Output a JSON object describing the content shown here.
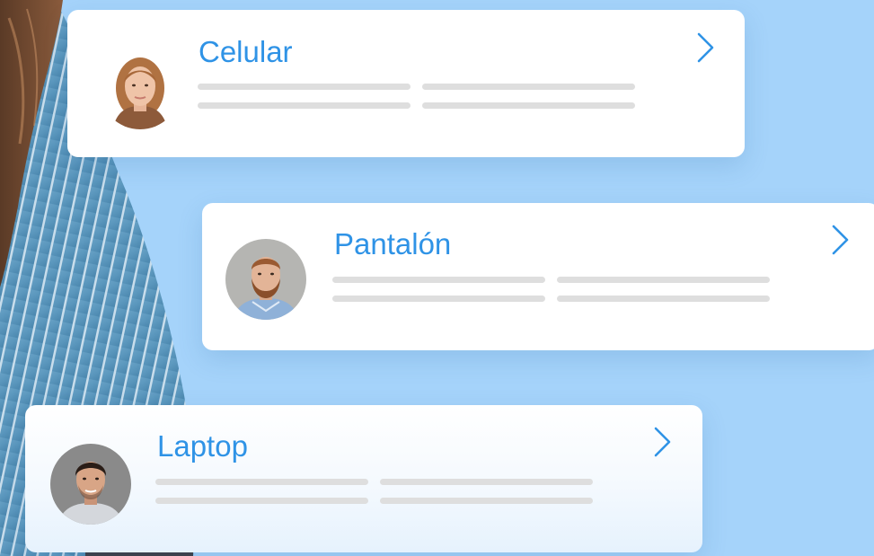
{
  "theme": {
    "background": "#a5d3fa",
    "accent": "#2f93e6",
    "placeholder_line": "#dedede"
  },
  "cards": [
    {
      "title": "Celular",
      "avatar": "woman-portrait",
      "action_icon": "chevron-right-icon"
    },
    {
      "title": "Pantalón",
      "avatar": "bearded-man-portrait",
      "action_icon": "chevron-right-icon"
    },
    {
      "title": "Laptop",
      "avatar": "young-man-portrait",
      "action_icon": "chevron-right-icon"
    }
  ]
}
